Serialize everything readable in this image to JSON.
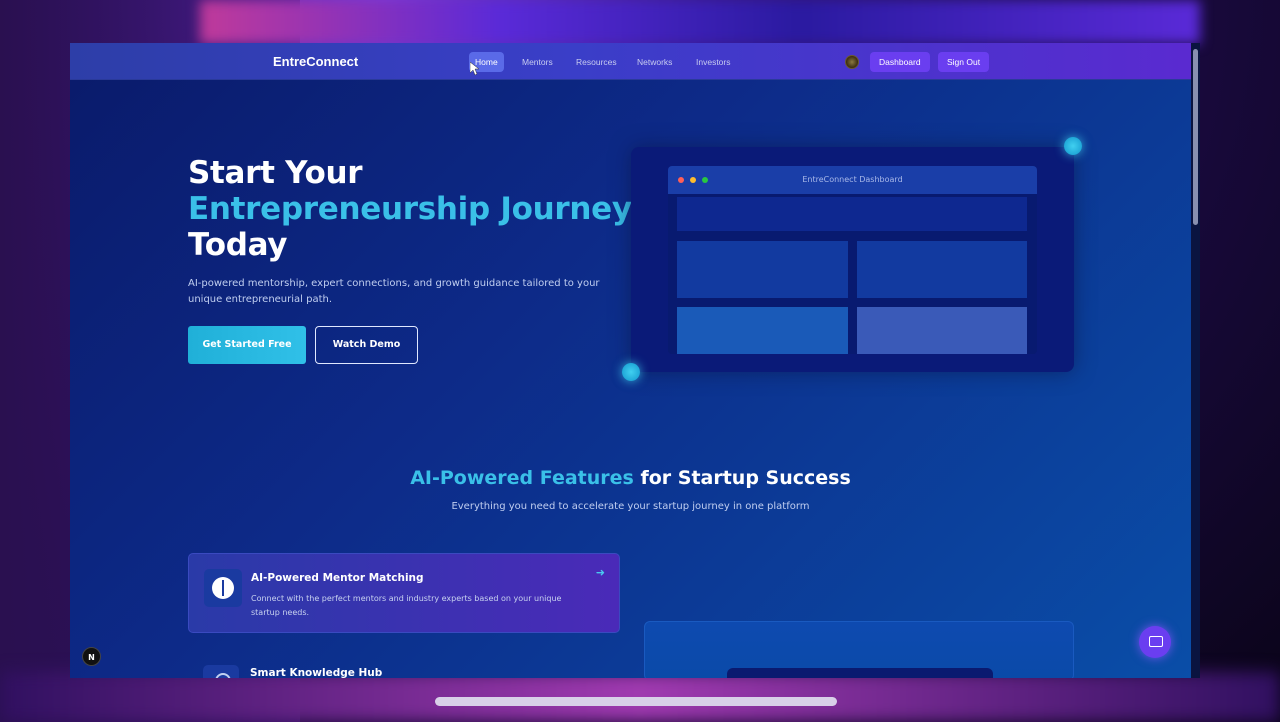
{
  "navbar": {
    "logo": "EntreConnect",
    "links": [
      "Home",
      "Mentors",
      "Resources",
      "Networks",
      "Investors"
    ],
    "active_link": "Home",
    "dashboard_label": "Dashboard",
    "signout_label": "Sign Out"
  },
  "hero": {
    "title_line1": "Start Your",
    "title_accent": "Entrepreneurship Journey",
    "title_line3": "Today",
    "subtitle": "AI-powered mentorship, expert connections, and growth guidance tailored to your unique entrepreneurial path.",
    "primary_button": "Get Started Free",
    "secondary_button": "Watch Demo"
  },
  "mockup": {
    "window_title": "EntreConnect Dashboard"
  },
  "features": {
    "title_accent": "AI-Powered Features",
    "title_rest": " for Startup Success",
    "subtitle": "Everything you need to accelerate your startup journey in one platform",
    "cards": [
      {
        "title": "AI-Powered Mentor Matching",
        "description": "Connect with the perfect mentors and industry experts based on your unique startup needs."
      },
      {
        "title": "Smart Knowledge Hub",
        "description": ""
      }
    ]
  },
  "misc": {
    "n_badge": "N"
  },
  "colors": {
    "accent": "#3ac0e8",
    "purple": "#6a3ef0",
    "background": "#0d2a88"
  }
}
